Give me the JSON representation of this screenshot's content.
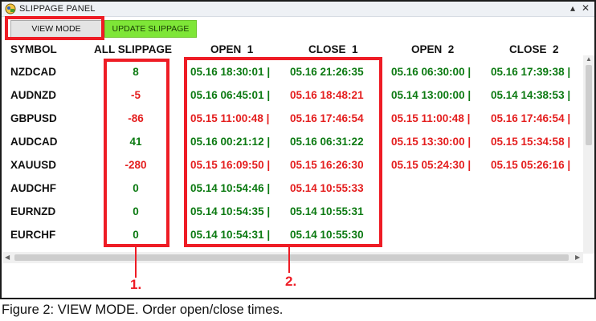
{
  "window": {
    "title": "SLIPPAGE PANEL",
    "minimize_glyph": "▴",
    "close_glyph": "✕"
  },
  "toolbar": {
    "view_mode_label": "VIEW MODE",
    "update_slippage_label": "UPDATE SLIPPAGE"
  },
  "table": {
    "columns": [
      "SYMBOL",
      "ALL SLIPPAGE",
      "OPEN  1",
      "CLOSE  1",
      "OPEN  2",
      "CLOSE  2"
    ],
    "rows": [
      {
        "symbol": "NZDCAD",
        "slippage": "8",
        "open1": "05.16 18:30:01 |",
        "close1": "05.16 21:26:35",
        "open2": "05.16 06:30:00 |",
        "close2": "05.16 17:39:38 |"
      },
      {
        "symbol": "AUDNZD",
        "slippage": "-5",
        "open1": "05.16 06:45:01 |",
        "close1": "05.16 18:48:21",
        "open2": "05.14 13:00:00 |",
        "close2": "05.14 14:38:53 |"
      },
      {
        "symbol": "GBPUSD",
        "slippage": "-86",
        "open1": "05.15 11:00:48 |",
        "close1": "05.16 17:46:54",
        "open2": "05.15 11:00:48 |",
        "close2": "05.16 17:46:54 |"
      },
      {
        "symbol": "AUDCAD",
        "slippage": "41",
        "open1": "05.16 00:21:12 |",
        "close1": "05.16 06:31:22",
        "open2": "05.15 13:30:00 |",
        "close2": "05.15 15:34:58 |"
      },
      {
        "symbol": "XAUUSD",
        "slippage": "-280",
        "open1": "05.15 16:09:50 |",
        "close1": "05.15 16:26:30",
        "open2": "05.15 05:24:30 |",
        "close2": "05.15 05:26:16 |"
      },
      {
        "symbol": "AUDCHF",
        "slippage": "0",
        "open1": "05.14 10:54:46 |",
        "close1": "05.14 10:55:33",
        "open2": "",
        "close2": ""
      },
      {
        "symbol": "EURNZD",
        "slippage": "0",
        "open1": "05.14 10:54:35 |",
        "close1": "05.14 10:55:31",
        "open2": "",
        "close2": ""
      },
      {
        "symbol": "EURCHF",
        "slippage": "0",
        "open1": "05.14 10:54:31 |",
        "close1": "05.14 10:55:30",
        "open2": "",
        "close2": ""
      }
    ]
  },
  "annotations": {
    "label_1": "1.",
    "label_2": "2.",
    "highlight_color": "#ee1c25"
  },
  "caption": "Figure 2: VIEW MODE. Order open/close times.",
  "colors": {
    "positive": "#0c7a12",
    "negative": "#e41e1e",
    "update_button": "#7ee637"
  },
  "icons": {
    "app": "app-logo-icon",
    "scroll_up": "scroll-up-icon",
    "scroll_down": "scroll-down-icon",
    "scroll_left": "scroll-left-icon",
    "scroll_right": "scroll-right-icon"
  }
}
